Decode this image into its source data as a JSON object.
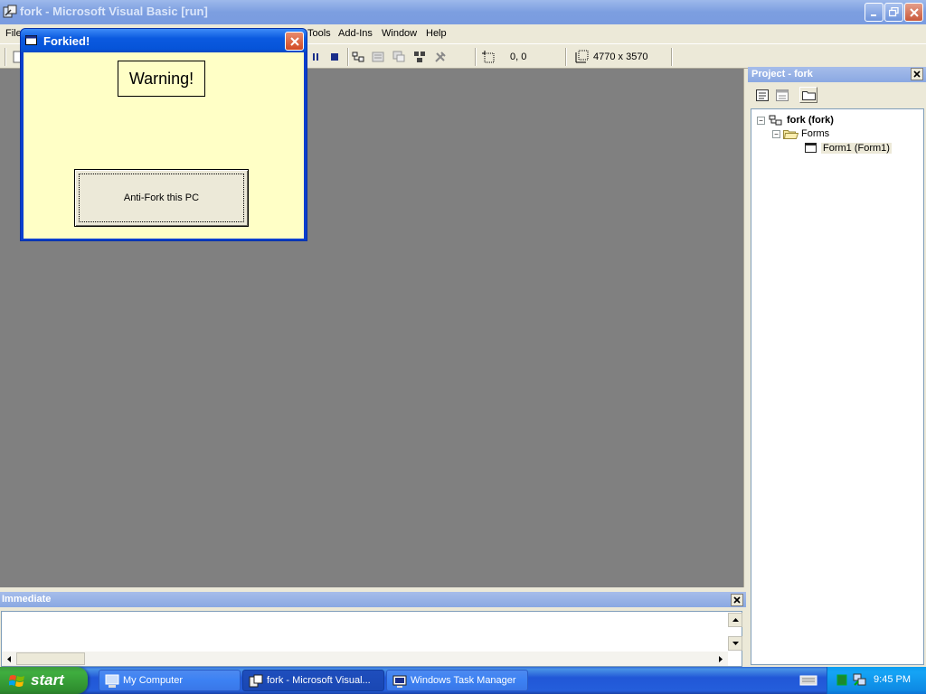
{
  "window": {
    "title": "fork - Microsoft Visual Basic [run]"
  },
  "menu": {
    "file": "File",
    "tools": "Tools",
    "addins": "Add-Ins",
    "window": "Window",
    "help": "Help"
  },
  "toolbar": {
    "position": "0, 0",
    "size": "4770 x 3570"
  },
  "project": {
    "title": "Project - fork",
    "tree": {
      "root": "fork (fork)",
      "folder": "Forms",
      "item": "Form1 (Form1)"
    }
  },
  "immediate": {
    "title": "Immediate"
  },
  "dialog": {
    "title": "Forkied!",
    "warning": "Warning!",
    "button": "Anti-Fork this PC"
  },
  "taskbar": {
    "start": "start",
    "tasks": [
      {
        "label": "My Computer"
      },
      {
        "label": "fork - Microsoft Visual..."
      },
      {
        "label": "Windows Task Manager"
      }
    ],
    "clock": "9:45 PM"
  },
  "colors": {
    "workspace": "#808080",
    "dialog_client": "#ffffc6",
    "dialog_titlebar": "#0654d8",
    "taskbar": "#245edb",
    "start_button": "#3fae3f"
  }
}
